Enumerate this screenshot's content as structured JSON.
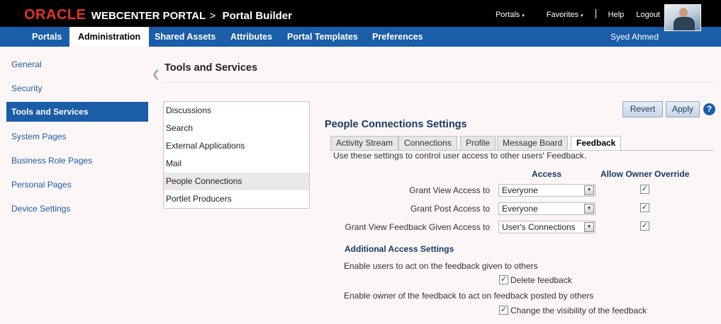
{
  "header": {
    "brand": "ORACLE",
    "product": "WEBCENTER PORTAL",
    "separator": ">",
    "app": "Portal Builder",
    "links": {
      "portals": "Portals",
      "favorites": "Favorites",
      "help": "Help",
      "logout": "Logout"
    },
    "dropdown_glyph": "▾"
  },
  "nav": {
    "tabs": [
      "Portals",
      "Administration",
      "Shared Assets",
      "Attributes",
      "Portal Templates",
      "Preferences"
    ],
    "active": "Administration",
    "user": "Syed Ahmed"
  },
  "sidebar": {
    "items": [
      "General",
      "Security",
      "Tools and Services",
      "System Pages",
      "Business Role Pages",
      "Personal Pages",
      "Device Settings"
    ],
    "active": "Tools and Services",
    "collapse_icon": "chevron-left-icon"
  },
  "main": {
    "title": "Tools and Services",
    "services": [
      "Discussions",
      "Search",
      "External Applications",
      "Mail",
      "People Connections",
      "Portlet Producers"
    ],
    "selected_service": "People Connections",
    "buttons": {
      "revert": "Revert",
      "apply": "Apply",
      "help": "?"
    },
    "settings": {
      "title": "People Connections Settings",
      "tabs": [
        "Activity Stream",
        "Connections",
        "Profile",
        "Message Board",
        "Feedback"
      ],
      "active_tab": "Feedback",
      "description": "Use these settings to control user access to other users' Feedback.",
      "columns": {
        "access": "Access",
        "override": "Allow Owner Override"
      },
      "rows": [
        {
          "label": "Grant View Access to",
          "value": "Everyone",
          "override": true
        },
        {
          "label": "Grant Post Access to",
          "value": "Everyone",
          "override": true
        },
        {
          "label": "Grant View Feedback Given Access to",
          "value": "User's Connections",
          "override": true
        }
      ],
      "checkmark": "✓",
      "additional": {
        "title": "Additional Access Settings",
        "line1": "Enable users to act on the feedback given to others",
        "delete_label": "Delete feedback",
        "delete_checked": true,
        "line2": "Enable owner of the feedback to act on feedback posted by others",
        "visibility_label": "Change the visibility of the feedback",
        "visibility_checked": true
      }
    }
  },
  "colors": {
    "brand_red": "#e3352a",
    "nav_blue": "#1a5da8",
    "heading_navy": "#163b63",
    "link_blue": "#1c5eab"
  }
}
